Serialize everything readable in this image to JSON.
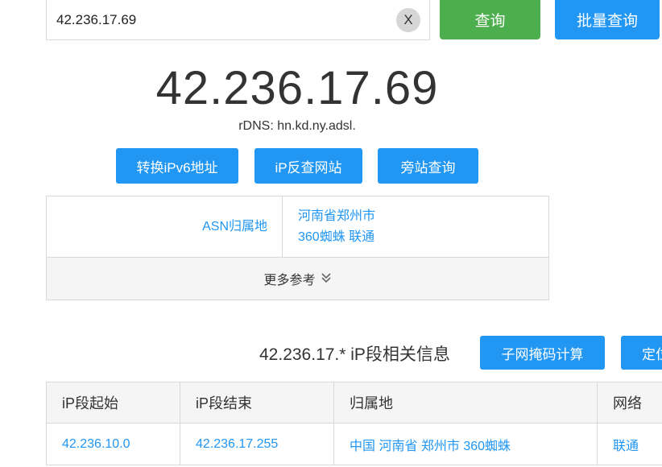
{
  "search": {
    "value": "42.236.17.69",
    "clear_label": "X"
  },
  "buttons": {
    "query": "查询",
    "batch_query": "批量查询",
    "ipv6": "转换iPv6地址",
    "reverse_site": "iP反查网站",
    "side_site": "旁站查询",
    "subnet_calc": "子网掩码计算",
    "locate": "定位"
  },
  "result": {
    "ip": "42.236.17.69",
    "rdns": "rDNS: hn.kd.ny.adsl."
  },
  "info": {
    "asn_label": "ASN归属地",
    "asn_value_line1": "河南省郑州市",
    "asn_value_line2": "360蜘蛛 联通",
    "more": "更多参考"
  },
  "segment": {
    "title": "42.236.17.* iP段相关信息",
    "headers": [
      "iP段起始",
      "iP段结束",
      "归属地",
      "网络"
    ],
    "rows": [
      [
        "42.236.10.0",
        "42.236.17.255",
        "中国 河南省 郑州市 360蜘蛛",
        "联通"
      ]
    ]
  },
  "colors": {
    "blue": "#2196f3",
    "green": "#4cae4c"
  }
}
